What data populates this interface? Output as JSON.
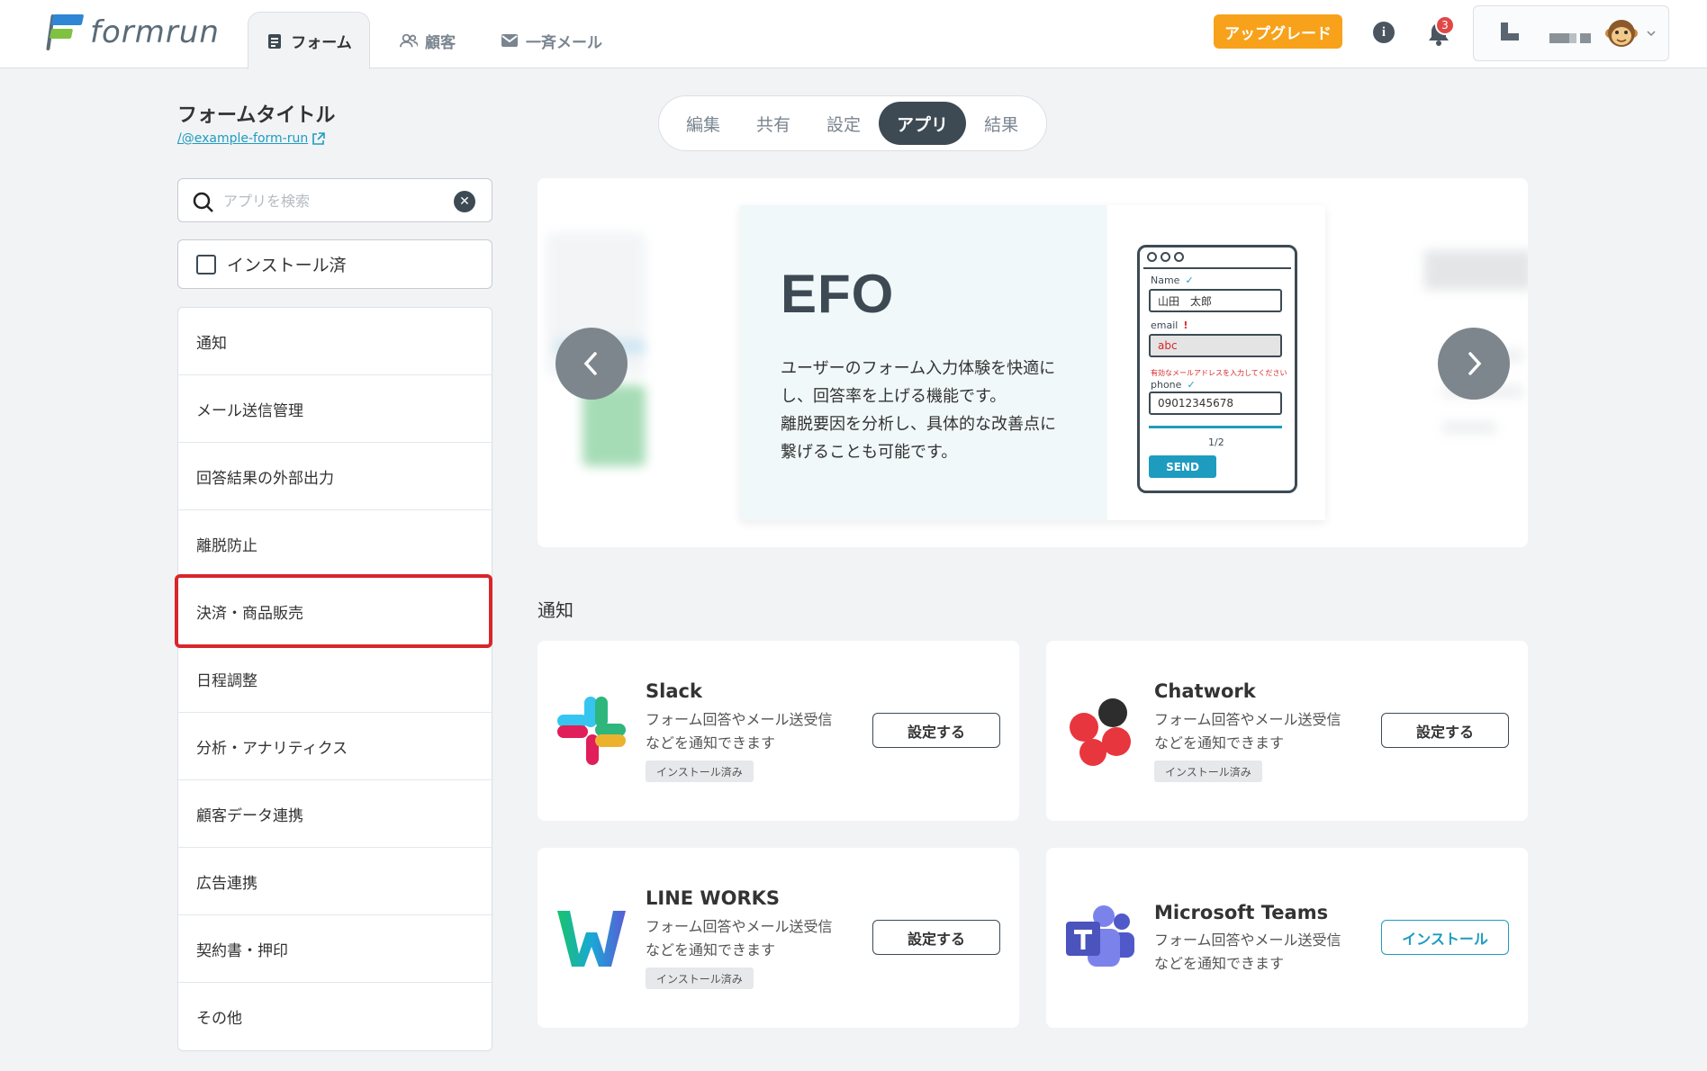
{
  "header": {
    "logo_text": "formrun",
    "tabs": [
      {
        "label": "フォーム",
        "icon": "form-icon"
      },
      {
        "label": "顧客",
        "icon": "users-icon"
      },
      {
        "label": "一斉メール",
        "icon": "mail-icon"
      }
    ],
    "upgrade_label": "アップグレード",
    "info_icon_glyph": "i",
    "notification_count": "3"
  },
  "page": {
    "title": "フォームタイトル",
    "link": "/@example-form-run"
  },
  "subtabs": [
    "編集",
    "共有",
    "設定",
    "アプリ",
    "結果"
  ],
  "subtab_active": "アプリ",
  "sidebar": {
    "search_placeholder": "アプリを検索",
    "installed_filter_label": "インストール済",
    "categories": [
      "通知",
      "メール送信管理",
      "回答結果の外部出力",
      "離脱防止",
      "決済・商品販売",
      "日程調整",
      "分析・アナリティクス",
      "顧客データ連携",
      "広告連携",
      "契約書・押印",
      "その他"
    ],
    "highlighted_category": "決済・商品販売"
  },
  "carousel": {
    "slide_title": "EFO",
    "slide_desc_lines": [
      "ユーザーのフォーム入力体験を快適に",
      "し、回答率を上げる機能です。",
      "離脱要因を分析し、具体的な改善点に",
      "繋げることも可能です。"
    ],
    "mock": {
      "name_label": "Name",
      "name_value": "山田　太郎",
      "email_label": "email",
      "email_value": "abc",
      "email_error": "有効なメールアドレスを入力してください",
      "phone_label": "phone",
      "phone_value": "09012345678",
      "page_indicator": "1/2",
      "send_label": "SEND",
      "check_glyph": "✓",
      "warn_glyph": "!"
    }
  },
  "section": {
    "title": "通知",
    "apps": [
      {
        "name": "Slack",
        "desc_lines": [
          "フォーム回答やメール送受信",
          "などを通知できます"
        ],
        "badge": "インストール済み",
        "button": "設定する",
        "installed": true
      },
      {
        "name": "Chatwork",
        "desc_lines": [
          "フォーム回答やメール送受信",
          "などを通知できます"
        ],
        "badge": "インストール済み",
        "button": "設定する",
        "installed": true
      },
      {
        "name": "LINE WORKS",
        "desc_lines": [
          "フォーム回答やメール送受信",
          "などを通知できます"
        ],
        "badge": "インストール済み",
        "button": "設定する",
        "installed": true
      },
      {
        "name": "Microsoft Teams",
        "desc_lines": [
          "フォーム回答やメール送受信",
          "などを通知できます"
        ],
        "badge": "",
        "button": "インストール",
        "installed": false
      }
    ]
  },
  "colors": {
    "accent": "#1e9cc0",
    "upgrade": "#f7a21a",
    "highlight": "#d8262a",
    "dark": "#3d4a54"
  }
}
